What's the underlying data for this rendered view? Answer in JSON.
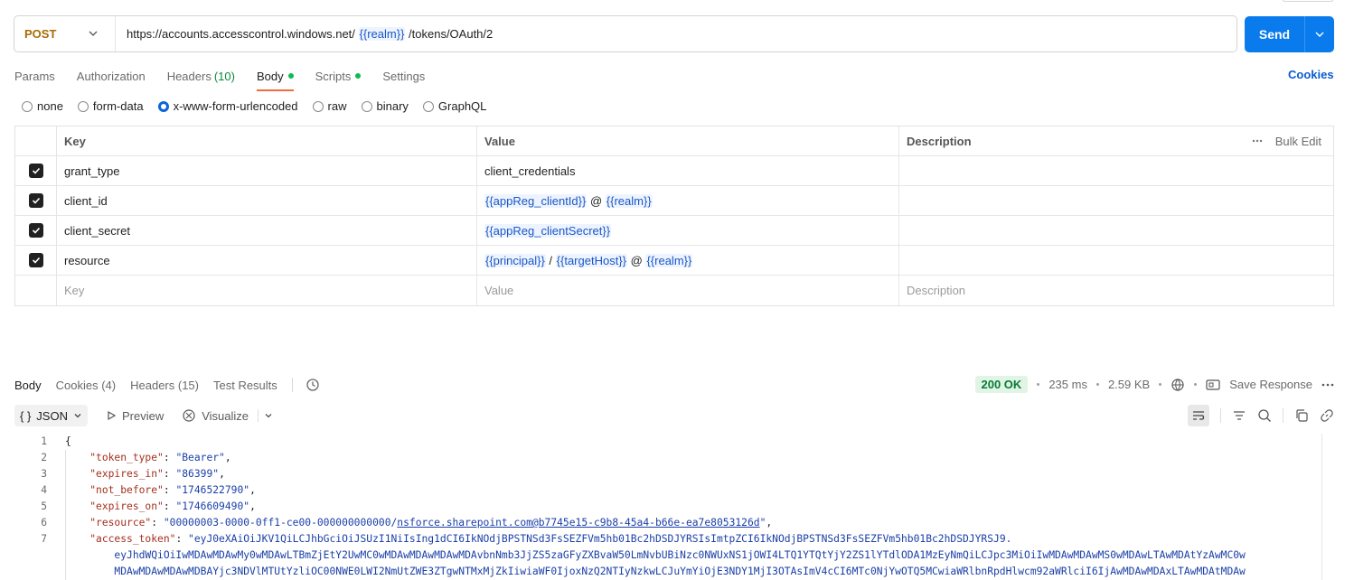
{
  "request": {
    "method": "POST",
    "url_prefix": "https://accounts.accesscontrol.windows.net/",
    "url_var": "{{realm}}",
    "url_suffix": "/tokens/OAuth/2",
    "send_label": "Send"
  },
  "tabs": [
    {
      "label": "Params"
    },
    {
      "label": "Authorization"
    },
    {
      "label": "Headers",
      "count": "(10)"
    },
    {
      "label": "Body"
    },
    {
      "label": "Scripts"
    },
    {
      "label": "Settings"
    }
  ],
  "cookies_label": "Cookies",
  "body_types": [
    "none",
    "form-data",
    "x-www-form-urlencoded",
    "raw",
    "binary",
    "GraphQL"
  ],
  "table": {
    "headers": {
      "key": "Key",
      "value": "Value",
      "description": "Description",
      "bulk_edit": "Bulk Edit"
    },
    "rows": [
      {
        "key": "grant_type",
        "value": "client_credentials"
      },
      {
        "key": "client_id",
        "v1": "{{appReg_clientId}}",
        "sep1": "@",
        "v2": "{{realm}}"
      },
      {
        "key": "client_secret",
        "v1": "{{appReg_clientSecret}}"
      },
      {
        "key": "resource",
        "v1": "{{principal}}",
        "sep1": "/",
        "v2": "{{targetHost}}",
        "sep2": "@",
        "v3": "{{realm}}"
      }
    ],
    "placeholder": {
      "key": "Key",
      "value": "Value",
      "description": "Description"
    }
  },
  "response": {
    "tabs": [
      "Body",
      "Cookies (4)",
      "Headers (15)",
      "Test Results"
    ],
    "status": "200 OK",
    "time": "235 ms",
    "size": "2.59 KB",
    "save_label": "Save Response",
    "format": "JSON",
    "preview_label": "Preview",
    "visualize_label": "Visualize"
  },
  "code": {
    "l1": "{",
    "token_type_k": "\"token_type\"",
    "token_type_v": "\"Bearer\"",
    "expires_in_k": "\"expires_in\"",
    "expires_in_v": "\"86399\"",
    "not_before_k": "\"not_before\"",
    "not_before_v": "\"1746522790\"",
    "expires_on_k": "\"expires_on\"",
    "expires_on_v": "\"1746609490\"",
    "resource_k": "\"resource\"",
    "resource_v1": "\"00000003-0000-0ff1-ce00-000000000000/",
    "resource_v2": "nsforce.sharepoint.com@b7745e15-c9b8-45a4-b66e-ea7e8053126d",
    "resource_v3": "\"",
    "access_token_k": "\"access_token\"",
    "access_token_v1": "\"eyJ0eXAiOiJKV1QiLCJhbGciOiJSUzI1NiIsIng1dCI6IkNOdjBPSTNSd3FsSEZFVm5hb01Bc2hDSDJYRSIsImtpZCI6IkNOdjBPSTNSd3FsSEZFVm5hb01Bc2hDSDJYRSJ9.",
    "access_token_v2": "eyJhdWQiOiIwMDAwMDAwMy0wMDAwLTBmZjEtY2UwMC0wMDAwMDAwMDAwMDAvbnNmb3JjZS5zaGFyZXBvaW50LmNvbUBiNzc0NWUxNS1jOWI4LTQ1YTQtYjY2ZS1lYTdlODA1MzEyNmQiLCJpc3MiOiIwMDAwMDAwMS0wMDAwLTAwMDAtYzAwMC0w",
    "access_token_v3": "MDAwMDAwMDAwMDBAYjc3NDVlMTUtYzliOC00NWE0LWI2NmUtZWE3ZTgwNTMxMjZkIiwiaWF0IjoxNzQ2NTIyNzkwLCJuYmYiOjE3NDY1MjI3OTAsImV4cCI6MTc0NjYwOTQ5MCwiaWRlbnRpdHlwcm92aWRlciI6IjAwMDAwMDAxLTAwMDAtMDAw"
  }
}
